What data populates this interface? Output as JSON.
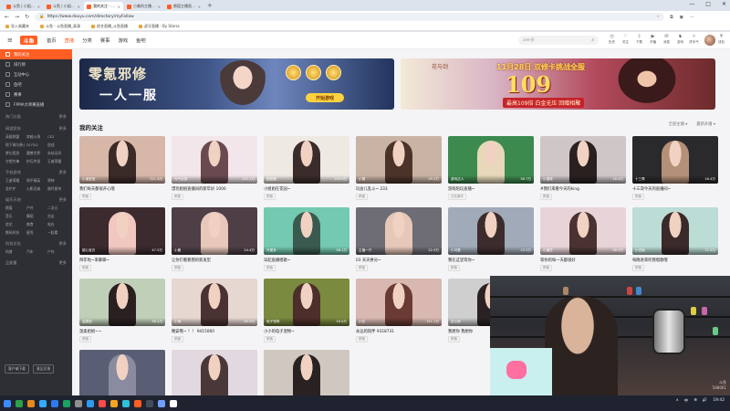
{
  "browser": {
    "tabs": [
      {
        "label": "斗鱼 | 小姐姐直播_美女直播",
        "color": "#ff5d23",
        "active": false
      },
      {
        "label": "斗鱼 | 小姐姐直播_美女直播",
        "color": "#ff5d23",
        "active": false
      },
      {
        "label": "我的关注 - 斗鱼",
        "color": "#ff5d23",
        "active": true
      },
      {
        "label": "小美的主播 小美在斗鱼直播",
        "color": "#ff5d23",
        "active": false
      },
      {
        "label": "颜值主播直播间 - 斗鱼",
        "color": "#ff5d23",
        "active": false
      }
    ],
    "new_tab": "+",
    "window_controls": [
      "—",
      "□",
      "✕"
    ],
    "url": "https://www.douyu.com/directory/myFollow",
    "bookmarks": [
      "导入收藏夹",
      "斗鱼 - 斗鱼直播_高清",
      "综艺直播_斗鱼直播",
      "虎牙直播 - By Starss"
    ]
  },
  "header": {
    "logo": "斗鱼",
    "nav": [
      "首页",
      "直播",
      "分类",
      "赛事",
      "游戏",
      "鱼吧"
    ],
    "active_nav": "直播",
    "search_placeholder": "zeer多",
    "icons": [
      {
        "label": "历史",
        "glyph": "◷"
      },
      {
        "label": "关注",
        "glyph": "♡"
      },
      {
        "label": "下载",
        "glyph": "⇩"
      },
      {
        "label": "开播",
        "glyph": "▶"
      },
      {
        "label": "消息",
        "glyph": "✉"
      },
      {
        "label": "游戏",
        "glyph": "♞"
      },
      {
        "label": "拼手气",
        "glyph": "✧"
      },
      {
        "label": "任务",
        "glyph": "✓"
      },
      {
        "label": "钱包",
        "glyph": "¥"
      }
    ]
  },
  "sidebar": {
    "items": [
      {
        "label": "我的关注",
        "active": true
      },
      {
        "label": "排行榜",
        "active": false
      },
      {
        "label": "互动中心",
        "active": false
      },
      {
        "label": "鱼吧",
        "active": false
      },
      {
        "label": "赛事",
        "active": false
      }
    ],
    "promo": "FPMA大师赛直播",
    "sections": [
      {
        "title": "热门分类",
        "more": "更多",
        "items": []
      },
      {
        "title": "网游竞技",
        "more": "更多",
        "items": [
          "英雄联盟",
          "穿越火线",
          "CS2",
          "地下城与勇士",
          "DOTA2",
          "逆战",
          "梦幻西游",
          "魔兽世界",
          "永劫无间",
          "守望先锋",
          "炉石传说",
          "王者荣耀"
        ]
      },
      {
        "title": "手机游戏",
        "more": "更多",
        "items": [
          "王者荣耀",
          "和平精英",
          "原神",
          "金铲铲",
          "火影忍者",
          "崩坏星穹"
        ]
      },
      {
        "title": "娱乐天地",
        "more": "更多",
        "items": [
          "颜值",
          "户外",
          "二次元",
          "音乐",
          "舞蹈",
          "交友",
          "综艺",
          "美食",
          "电台",
          "数码科技",
          "星秀",
          "一起看"
        ]
      },
      {
        "title": "科技文化",
        "more": "更多",
        "items": [
          "科普",
          "汽车",
          "户外"
        ]
      },
      {
        "title": "正能量",
        "more": "更多",
        "items": []
      }
    ],
    "footer_buttons": [
      "客户端下载",
      "意见反馈"
    ]
  },
  "banners": [
    {
      "title": "零氪邪修",
      "subtitle": "一人一服",
      "button": "开始游戏"
    },
    {
      "logo": "花与剑",
      "date": "11月28日 双修卡挑战全服",
      "big": "109",
      "tagline": "最高109倍 白金无压 回赠相聚"
    }
  ],
  "main": {
    "section_title": "我的关注",
    "sort_options": [
      "全部主播",
      "最新开播"
    ],
    "cards": [
      {
        "title": "我们每天都很开心哦",
        "tag": "颜值",
        "streamer": "小溪宝宝",
        "viewers": "311.4万",
        "bg": "#d7b7a8",
        "fig": "#3a2a28"
      },
      {
        "title": "漂亮姐姐直播间的新年好 1000",
        "tag": "颜值",
        "streamer": "元气女孩",
        "viewers": "120.1万",
        "bg": "#f3e6ea",
        "fig": "#6a4a50"
      },
      {
        "title": "小姐姐在花园~",
        "tag": "颜值",
        "streamer": "甜甜酱",
        "viewers": "194.9万",
        "bg": "#efe9e4",
        "fig": "#3a2c2a"
      },
      {
        "title": "玩会儿乱斗~ 233",
        "tag": "颜值",
        "streamer": "小雪",
        "viewers": "29.2万",
        "bg": "#c9b3a4",
        "fig": "#4b3329"
      },
      {
        "title": "游戏陪玩直播~",
        "tag": "交友娱乐",
        "streamer": "游戏达人",
        "viewers": "58.7万",
        "bg": "#3c8a4e",
        "fig": "#e6d8b8"
      },
      {
        "title": "#我们来看今天的king",
        "tag": "颜值",
        "streamer": "小猫咪",
        "viewers": "16.4万",
        "bg": "#cfc6c8",
        "fig": "#2a2020"
      },
      {
        "title": "十三哥今天的直播间~",
        "tag": "颜值",
        "streamer": "十三哥",
        "viewers": "16.4万",
        "bg": "#2a2a2c",
        "fig": "#b59078"
      },
      {
        "title": "拜年啦~来聊聊~",
        "tag": "颜值",
        "streamer": "甜心宝贝",
        "viewers": "47.5万",
        "bg": "#3b2a2e",
        "fig": "#f0c8c0"
      },
      {
        "title": "让你们看看我的新发型",
        "tag": "颜值",
        "streamer": "小鹿",
        "viewers": "24.4万",
        "bg": "#4e3e46",
        "fig": "#e8c8bb"
      },
      {
        "title": "早起直播唱歌~",
        "tag": "颜值",
        "streamer": "可爱多",
        "viewers": "58.1万",
        "bg": "#74c9b1",
        "fig": "#3a5a50"
      },
      {
        "title": "03 天天拼分~",
        "tag": "颜值",
        "streamer": "主播一只",
        "viewers": "22.9万",
        "bg": "#6e6c74",
        "fig": "#e6c8b8"
      },
      {
        "title": "我在这里等你~",
        "tag": "颜值",
        "streamer": "小可爱",
        "viewers": "15.5万",
        "bg": "#a0aab8",
        "fig": "#3c2c2c"
      },
      {
        "title": "等你的每一天都很好",
        "tag": "颜值",
        "streamer": "小糖豆",
        "viewers": "28.9万",
        "bg": "#e8d4d8",
        "fig": "#4a3232"
      },
      {
        "title": "每晚进来听我唱歌哦",
        "tag": "颜值",
        "streamer": "小白兔",
        "viewers": "71.5万",
        "bg": "#bcdcd6",
        "fig": "#3a2a2a"
      },
      {
        "title": "温柔姐姐~~",
        "tag": "颜值",
        "streamer": "温柔姐",
        "viewers": "56.2万",
        "bg": "#c0d0b8",
        "fig": "#2a2020"
      },
      {
        "title": "晚安哦~ ！！ 9415060",
        "tag": "颜值",
        "streamer": "小雨",
        "viewers": "40.5万",
        "bg": "#e6d7d0",
        "fig": "#4a3232"
      },
      {
        "title": "小小的电子宠物~",
        "tag": "颜值",
        "streamer": "电子宠物",
        "viewers": "19.0万",
        "bg": "#7a8a3e",
        "fig": "#4d2e2a"
      },
      {
        "title": "永远的陪伴 9318731",
        "tag": "颜值",
        "streamer": "小花",
        "viewers": "111.1万",
        "bg": "#d8b8b0",
        "fig": "#6a3a34"
      },
      {
        "title": "我想你 我想你",
        "tag": "颜值",
        "streamer": "苏小妹",
        "viewers": "48.4万",
        "bg": "#cfcfcf",
        "fig": "#2a2222"
      },
      {
        "title": "",
        "tag": "",
        "streamer": "",
        "viewers": "",
        "bg": "#d8b8a8",
        "fig": "#3a2828"
      },
      {
        "title": "",
        "tag": "",
        "streamer": "",
        "viewers": "",
        "bg": "#3a3b48",
        "fig": "#efd2c6"
      },
      {
        "title": "",
        "tag": "",
        "streamer": "",
        "viewers": "",
        "bg": "#5a5e74",
        "fig": "#8a8aa0"
      },
      {
        "title": "",
        "tag": "",
        "streamer": "",
        "viewers": "",
        "bg": "#e2d8e0",
        "fig": "#4a3838"
      },
      {
        "title": "",
        "tag": "",
        "streamer": "",
        "viewers": "",
        "bg": "#d0c8c0",
        "fig": "#2a2222"
      }
    ]
  },
  "webcam": {
    "watermark_top": "斗鱼",
    "watermark_bottom": "548061"
  },
  "taskbar": {
    "apps": [
      "#3b8cff",
      "#2ba24a",
      "#e88a1a",
      "#33aaff",
      "#2e7bf0",
      "#1aa260",
      "#8f8f8f",
      "#2d9cf0",
      "#ff4a4a",
      "#f5a623",
      "#2fc2d8",
      "#ff5d23",
      "#444c5c",
      "#6ea0ff",
      "#ffffff"
    ],
    "tray": [
      "∧",
      "中",
      "⊕",
      "🔊",
      "19:42"
    ]
  }
}
